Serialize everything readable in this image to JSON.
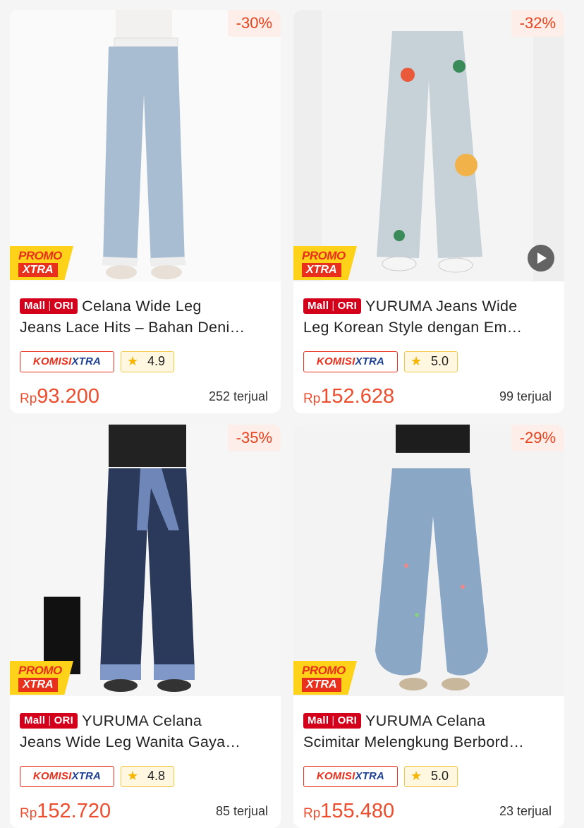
{
  "colors": {
    "accent": "#ee4d2d",
    "mall_red": "#d4001b",
    "promo_yellow": "#ffd21a",
    "komisi_blue": "#1c3f94"
  },
  "products": [
    {
      "discount": "-30%",
      "promo": {
        "line1": "PROMO",
        "line2": "XTRA"
      },
      "mall": {
        "left": "Mall",
        "right": "ORI"
      },
      "title_line1": "Celana Wide Leg",
      "title_line2": "Jeans Lace Hits – Bahan Deni…",
      "komisi": {
        "left": "KOMISI",
        "right": "XTRA"
      },
      "rating": "4.9",
      "price": {
        "currency": "Rp",
        "amount": "93.200"
      },
      "sold": "252 terjual",
      "has_video": false
    },
    {
      "discount": "-32%",
      "promo": {
        "line1": "PROMO",
        "line2": "XTRA"
      },
      "mall": {
        "left": "Mall",
        "right": "ORI"
      },
      "title_line1": "YURUMA Jeans Wide",
      "title_line2": "Leg Korean Style dengan Em…",
      "komisi": {
        "left": "KOMISI",
        "right": "XTRA"
      },
      "rating": "5.0",
      "price": {
        "currency": "Rp",
        "amount": "152.628"
      },
      "sold": "99 terjual",
      "has_video": true
    },
    {
      "discount": "-35%",
      "promo": {
        "line1": "PROMO",
        "line2": "XTRA"
      },
      "mall": {
        "left": "Mall",
        "right": "ORI"
      },
      "title_line1": "YURUMA Celana",
      "title_line2": "Jeans Wide Leg Wanita Gaya…",
      "komisi": {
        "left": "KOMISI",
        "right": "XTRA"
      },
      "rating": "4.8",
      "price": {
        "currency": "Rp",
        "amount": "152.720"
      },
      "sold": "85 terjual",
      "has_video": false
    },
    {
      "discount": "-29%",
      "promo": {
        "line1": "PROMO",
        "line2": "XTRA"
      },
      "mall": {
        "left": "Mall",
        "right": "ORI"
      },
      "title_line1": "YURUMA Celana",
      "title_line2": "Scimitar Melengkung Berbord…",
      "komisi": {
        "left": "KOMISI",
        "right": "XTRA"
      },
      "rating": "5.0",
      "price": {
        "currency": "Rp",
        "amount": "155.480"
      },
      "sold": "23 terjual",
      "has_video": false
    }
  ]
}
